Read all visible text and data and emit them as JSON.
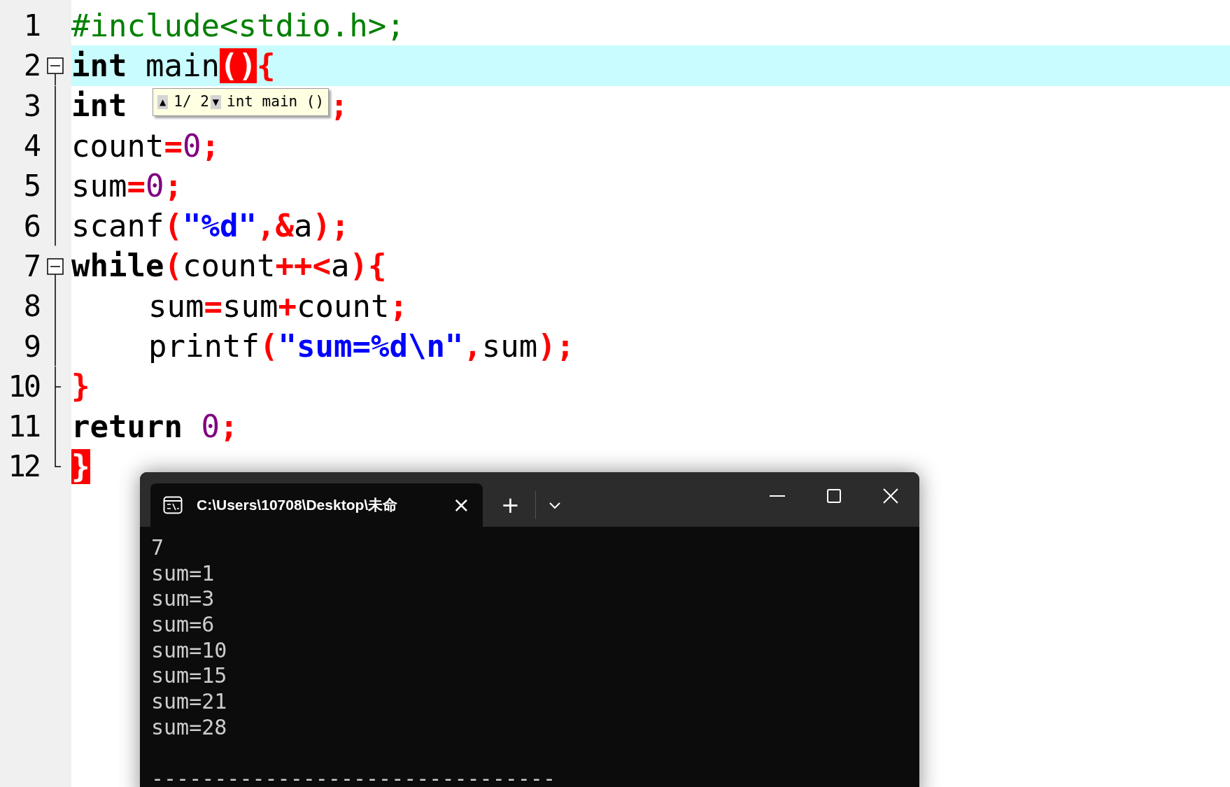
{
  "editor": {
    "lines": [
      {
        "number": "1",
        "kind": "plain",
        "current": false,
        "indented": false,
        "tokens": [
          {
            "text": "#include<stdio.h>;",
            "kind": "preproc"
          }
        ]
      },
      {
        "number": "2",
        "kind": "open",
        "current": true,
        "indented": false,
        "tokens": [
          {
            "text": "int",
            "kind": "keyword"
          },
          {
            "text": " main",
            "kind": "ident"
          },
          {
            "text": "()",
            "kind": "match"
          },
          {
            "text": "{",
            "kind": "op"
          }
        ]
      },
      {
        "number": "3",
        "kind": "line",
        "current": false,
        "indented": false,
        "covered": true,
        "tokens": [
          {
            "text": "int",
            "kind": "keyword"
          },
          {
            "text": ";",
            "kind": "op"
          }
        ]
      },
      {
        "number": "4",
        "kind": "line",
        "current": false,
        "indented": false,
        "tokens": [
          {
            "text": "count",
            "kind": "ident"
          },
          {
            "text": "=",
            "kind": "op"
          },
          {
            "text": "0",
            "kind": "number"
          },
          {
            "text": ";",
            "kind": "op"
          }
        ]
      },
      {
        "number": "5",
        "kind": "line",
        "current": false,
        "indented": false,
        "tokens": [
          {
            "text": "sum",
            "kind": "ident"
          },
          {
            "text": "=",
            "kind": "op"
          },
          {
            "text": "0",
            "kind": "number"
          },
          {
            "text": ";",
            "kind": "op"
          }
        ]
      },
      {
        "number": "6",
        "kind": "line",
        "current": false,
        "indented": false,
        "tokens": [
          {
            "text": "scanf",
            "kind": "ident"
          },
          {
            "text": "(",
            "kind": "op"
          },
          {
            "text": "\"%d\"",
            "kind": "string"
          },
          {
            "text": ",&",
            "kind": "op"
          },
          {
            "text": "a",
            "kind": "ident"
          },
          {
            "text": ");",
            "kind": "op"
          }
        ]
      },
      {
        "number": "7",
        "kind": "open",
        "current": false,
        "indented": false,
        "tokens": [
          {
            "text": "while",
            "kind": "keyword"
          },
          {
            "text": "(",
            "kind": "op"
          },
          {
            "text": "count",
            "kind": "ident"
          },
          {
            "text": "++<",
            "kind": "op"
          },
          {
            "text": "a",
            "kind": "ident"
          },
          {
            "text": "){",
            "kind": "op"
          }
        ]
      },
      {
        "number": "8",
        "kind": "line",
        "current": false,
        "indented": true,
        "tokens": [
          {
            "text": "sum",
            "kind": "ident"
          },
          {
            "text": "=",
            "kind": "op"
          },
          {
            "text": "sum",
            "kind": "ident"
          },
          {
            "text": "+",
            "kind": "op"
          },
          {
            "text": "count",
            "kind": "ident"
          },
          {
            "text": ";",
            "kind": "op"
          }
        ]
      },
      {
        "number": "9",
        "kind": "line",
        "current": false,
        "indented": true,
        "tokens": [
          {
            "text": "printf",
            "kind": "ident"
          },
          {
            "text": "(",
            "kind": "op"
          },
          {
            "text": "\"sum=%d\\n\"",
            "kind": "string"
          },
          {
            "text": ",",
            "kind": "op"
          },
          {
            "text": "sum",
            "kind": "ident"
          },
          {
            "text": ");",
            "kind": "op"
          }
        ]
      },
      {
        "number": "10",
        "kind": "branch",
        "current": false,
        "indented": false,
        "tokens": [
          {
            "text": "}",
            "kind": "op"
          }
        ]
      },
      {
        "number": "11",
        "kind": "line",
        "current": false,
        "indented": false,
        "tokens": [
          {
            "text": "return",
            "kind": "keyword"
          },
          {
            "text": " 0",
            "kind": "number"
          },
          {
            "text": ";",
            "kind": "op"
          }
        ]
      },
      {
        "number": "12",
        "kind": "end",
        "current": false,
        "indented": false,
        "tokens": [
          {
            "text": "}",
            "kind": "match"
          }
        ]
      }
    ]
  },
  "tooltip": {
    "up": "▲",
    "counter": "1/ 2",
    "down": "▼",
    "signature": "int main ()"
  },
  "terminal": {
    "tab_title": "C:\\Users\\10708\\Desktop\\未命",
    "close": "×",
    "new_tab": "+",
    "output": [
      "7",
      "sum=1",
      "sum=3",
      "sum=6",
      "sum=10",
      "sum=15",
      "sum=21",
      "sum=28"
    ],
    "separator": "--------------------------------"
  }
}
